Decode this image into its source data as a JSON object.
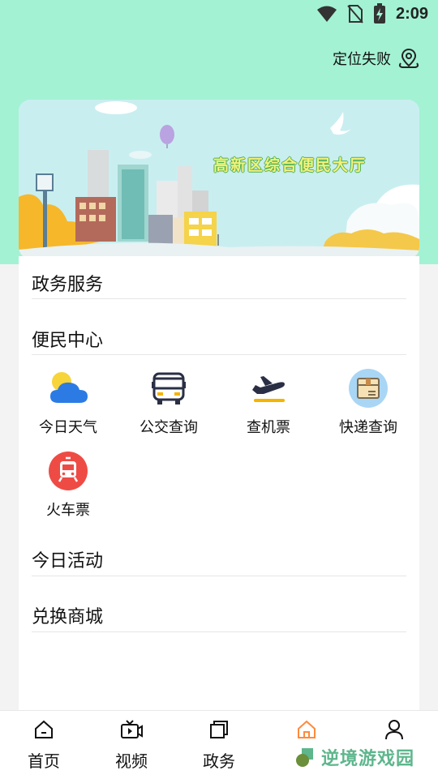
{
  "status_bar": {
    "time": "2:09"
  },
  "header": {
    "location_text": "定位失败",
    "location_icon": "location-pin-icon"
  },
  "banner": {
    "title": "高新区综合便民大厅"
  },
  "sections": {
    "government": {
      "title": "政务服务"
    },
    "convenience": {
      "title": "便民中心",
      "items": [
        {
          "label": "今日天气",
          "icon": "weather-icon"
        },
        {
          "label": "公交查询",
          "icon": "bus-icon"
        },
        {
          "label": "查机票",
          "icon": "airplane-icon"
        },
        {
          "label": "快递查询",
          "icon": "package-icon"
        },
        {
          "label": "火车票",
          "icon": "train-icon"
        }
      ]
    },
    "activities": {
      "title": "今日活动"
    },
    "mall": {
      "title": "兑换商城"
    }
  },
  "tabbar": {
    "tabs": [
      {
        "label": "首页",
        "icon": "home-icon"
      },
      {
        "label": "视频",
        "icon": "video-icon"
      },
      {
        "label": "政务",
        "icon": "layers-icon"
      },
      {
        "label": "",
        "icon": "home-active-icon"
      },
      {
        "label": "",
        "icon": "user-icon"
      }
    ]
  },
  "watermark": {
    "text": "逆境游戏园"
  },
  "colors": {
    "top_bg": "#a3f2d4",
    "accent": "#ff8a3d",
    "watermark": "#5db68c"
  }
}
